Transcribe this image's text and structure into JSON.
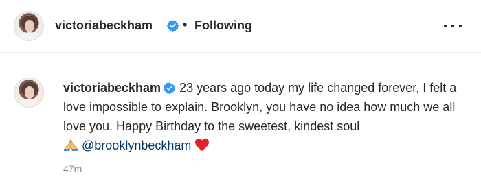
{
  "header": {
    "username": "victoriabeckham",
    "separator": "•",
    "follow_status": "Following"
  },
  "post": {
    "username": "victoriabeckham",
    "caption_text": "23 years ago today my life changed forever, I felt a love impossible to explain. Brooklyn, you have no idea how much we all love you. Happy Birthday to the sweetest, kindest soul",
    "mention": "@brooklynbeckham",
    "timestamp": "47m"
  },
  "icons": {
    "verified": "verified-badge-icon",
    "more": "more-options-icon",
    "praying_hands": "praying-hands-emoji",
    "heart": "red-heart-emoji"
  },
  "colors": {
    "verified_blue": "#3897f0",
    "mention_blue": "#00376b",
    "heart_red": "#e0202e",
    "muted_gray": "#8e8e8e"
  }
}
